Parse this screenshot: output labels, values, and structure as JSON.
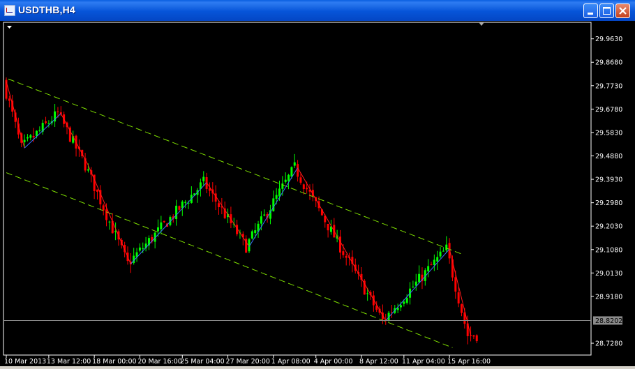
{
  "window": {
    "title": "USDTHB,H4",
    "buttons": {
      "minimize": "minimize-icon",
      "maximize": "maximize-icon",
      "close": "close-icon"
    }
  },
  "colors": {
    "background": "#000000",
    "bull_candle": "#00ff00",
    "bear_candle": "#ff0000",
    "channel": "#7fe000",
    "zigzag_up": "#3c6fff",
    "zigzag_down": "#ff1a1a",
    "bid_line": "#8c8c8c",
    "axis_text": "#ffffff"
  },
  "chart_data": {
    "type": "candlestick",
    "symbol": "USDTHB",
    "timeframe": "H4",
    "ylim": [
      28.68,
      30.03
    ],
    "price_ticks": [
      "29.9630",
      "29.8680",
      "29.7730",
      "29.6780",
      "29.5830",
      "29.4880",
      "29.3930",
      "29.2980",
      "29.2030",
      "29.1080",
      "29.0130",
      "28.9180",
      "28.7280"
    ],
    "current_price": "28.8202",
    "time_ticks": [
      "10 Mar 2013",
      "13 Mar 12:00",
      "18 Mar 00:00",
      "20 Mar 16:00",
      "25 Mar 04:00",
      "27 Mar 20:00",
      "1 Apr 08:00",
      "4 Apr 00:00",
      "8 Apr 12:00",
      "11 Apr 04:00",
      "15 Apr 16:00"
    ],
    "zigzag": [
      {
        "x": 0,
        "y": 29.79
      },
      {
        "x": 6,
        "y": 29.52
      },
      {
        "x": 18,
        "y": 29.66
      },
      {
        "x": 27,
        "y": 29.45
      },
      {
        "x": 41,
        "y": 29.05
      },
      {
        "x": 66,
        "y": 29.38
      },
      {
        "x": 80,
        "y": 29.12
      },
      {
        "x": 96,
        "y": 29.44
      },
      {
        "x": 125,
        "y": 28.82
      },
      {
        "x": 146,
        "y": 29.11
      },
      {
        "x": 153,
        "y": 28.76
      }
    ],
    "channel_upper": [
      {
        "x": 0,
        "y": 29.8
      },
      {
        "x": 150,
        "y": 29.09
      }
    ],
    "channel_lower": [
      {
        "x": 0,
        "y": 29.42
      },
      {
        "x": 147,
        "y": 28.71
      }
    ],
    "candle_count": 156
  }
}
